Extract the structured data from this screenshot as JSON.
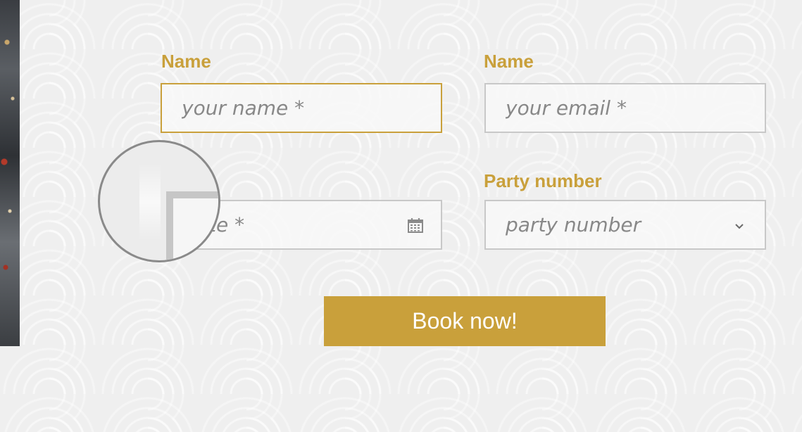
{
  "form": {
    "name_label": "Name",
    "name_placeholder": "your name *",
    "email_label": "Name",
    "email_placeholder": "your email *",
    "date_placeholder_fragment": "te *",
    "party_label": "Party number",
    "party_placeholder": "party number",
    "submit_label": "Book now!"
  },
  "icons": {
    "calendar": "calendar-icon",
    "chevron": "chevron-down-icon"
  },
  "colors": {
    "accent": "#c9a03b",
    "field_border": "#c8c8c8",
    "placeholder": "#888888",
    "button_text": "#ffffff"
  }
}
